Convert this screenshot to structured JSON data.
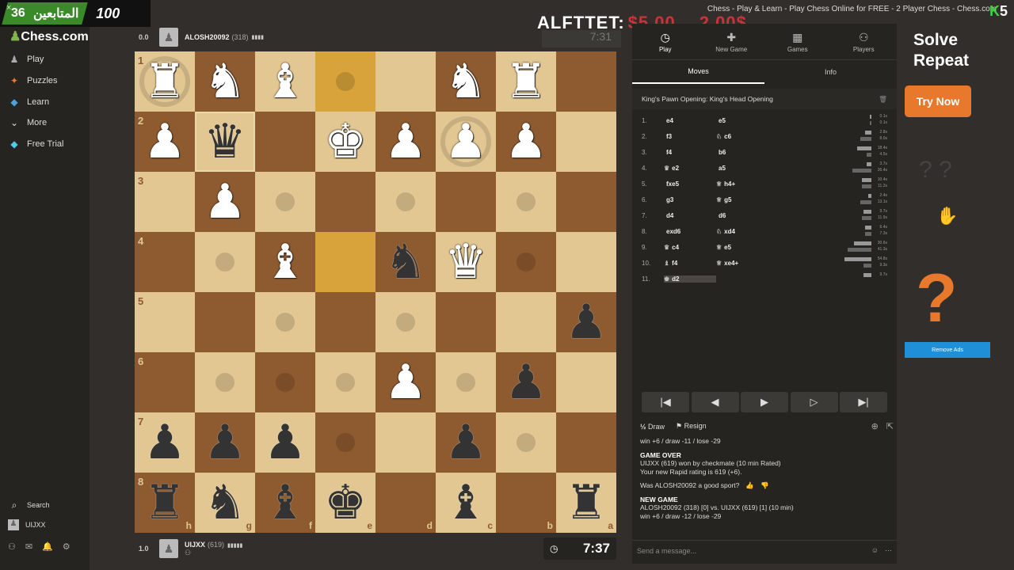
{
  "window": {
    "title": "Chess - Play & Learn - Play Chess Online for FREE - 2 Player Chess - Chess.com",
    "close": "×"
  },
  "stream_overlay": {
    "count_left": "36",
    "followers_label": "المتابعين",
    "count_right": "100",
    "alert_label": "ALFTTET:",
    "alert_amount1": "$5.00",
    "alert_amount2": "2.00$",
    "ghost_time": "7:31",
    "corner_mark": "K5"
  },
  "sidebar": {
    "logo": "Chess.com",
    "items": [
      {
        "label": "Play",
        "icon": "play-icon"
      },
      {
        "label": "Puzzles",
        "icon": "puzzle-icon"
      },
      {
        "label": "Learn",
        "icon": "learn-icon"
      },
      {
        "label": "More",
        "icon": "chevron-down-icon"
      },
      {
        "label": "Free Trial",
        "icon": "diamond-icon"
      }
    ],
    "search": "Search",
    "user": "UIJXX"
  },
  "top_player": {
    "score": "0.0",
    "name": "ALOSH20092",
    "rating": "(318)",
    "flag": "▮▮▮▮"
  },
  "bottom_player": {
    "score": "1.0",
    "name": "UIJXX",
    "rating": "(619)",
    "flag": "▮▮▮▮▮",
    "clock": "7:37"
  },
  "board": {
    "ranks": [
      "1",
      "2",
      "3",
      "4",
      "5",
      "6",
      "7",
      "8"
    ],
    "files": [
      "h",
      "g",
      "f",
      "e",
      "d",
      "c",
      "b",
      "a"
    ],
    "pieces": [
      {
        "r": 0,
        "c": 0,
        "p": "♜",
        "w": true
      },
      {
        "r": 0,
        "c": 1,
        "p": "♞",
        "w": true
      },
      {
        "r": 0,
        "c": 2,
        "p": "♝",
        "w": true
      },
      {
        "r": 0,
        "c": 5,
        "p": "♞",
        "w": true
      },
      {
        "r": 0,
        "c": 6,
        "p": "♜",
        "w": true
      },
      {
        "r": 1,
        "c": 0,
        "p": "♟",
        "w": true
      },
      {
        "r": 1,
        "c": 1,
        "p": "♛",
        "w": false
      },
      {
        "r": 1,
        "c": 3,
        "p": "♚",
        "w": true
      },
      {
        "r": 1,
        "c": 4,
        "p": "♟",
        "w": true
      },
      {
        "r": 1,
        "c": 5,
        "p": "♟",
        "w": true
      },
      {
        "r": 1,
        "c": 6,
        "p": "♟",
        "w": true
      },
      {
        "r": 2,
        "c": 1,
        "p": "♟",
        "w": true
      },
      {
        "r": 3,
        "c": 2,
        "p": "♝",
        "w": true
      },
      {
        "r": 3,
        "c": 4,
        "p": "♞",
        "w": false
      },
      {
        "r": 3,
        "c": 5,
        "p": "♛",
        "w": true
      },
      {
        "r": 4,
        "c": 7,
        "p": "♟",
        "w": false
      },
      {
        "r": 5,
        "c": 4,
        "p": "♟",
        "w": true
      },
      {
        "r": 5,
        "c": 6,
        "p": "♟",
        "w": false
      },
      {
        "r": 6,
        "c": 0,
        "p": "♟",
        "w": false
      },
      {
        "r": 6,
        "c": 1,
        "p": "♟",
        "w": false
      },
      {
        "r": 6,
        "c": 2,
        "p": "♟",
        "w": false
      },
      {
        "r": 6,
        "c": 5,
        "p": "♟",
        "w": false
      },
      {
        "r": 7,
        "c": 0,
        "p": "♜",
        "w": false
      },
      {
        "r": 7,
        "c": 1,
        "p": "♞",
        "w": false
      },
      {
        "r": 7,
        "c": 2,
        "p": "♝",
        "w": false
      },
      {
        "r": 7,
        "c": 3,
        "p": "♚",
        "w": false
      },
      {
        "r": 7,
        "c": 5,
        "p": "♝",
        "w": false
      },
      {
        "r": 7,
        "c": 7,
        "p": "♜",
        "w": false
      }
    ]
  },
  "panel": {
    "tabs": [
      {
        "label": "Play",
        "icon": "clock-icon"
      },
      {
        "label": "New Game",
        "icon": "plus-icon"
      },
      {
        "label": "Games",
        "icon": "board-icon"
      },
      {
        "label": "Players",
        "icon": "players-icon"
      }
    ],
    "subtabs": [
      "Moves",
      "Info"
    ],
    "opening": "King's Pawn Opening: King's Head Opening",
    "moves": [
      {
        "n": "1.",
        "w": "e4",
        "wp": "",
        "b": "e5",
        "bp": "",
        "t1": "0.1s",
        "t2": "0.1s",
        "b1": 2,
        "b2": 2
      },
      {
        "n": "2.",
        "w": "f3",
        "wp": "",
        "b": "c6",
        "bp": "♘",
        "t1": "2.8s",
        "t2": "8.0s",
        "b1": 8,
        "b2": 14
      },
      {
        "n": "3.",
        "w": "f4",
        "wp": "",
        "b": "b6",
        "bp": "",
        "t1": "18.4s",
        "t2": "4.5s",
        "b1": 18,
        "b2": 6
      },
      {
        "n": "4.",
        "w": "e2",
        "wp": "♛",
        "b": "a5",
        "bp": "",
        "t1": "3.7s",
        "t2": "26.4s",
        "b1": 6,
        "b2": 24
      },
      {
        "n": "5.",
        "w": "fxe5",
        "wp": "",
        "b": "h4+",
        "bp": "♕",
        "t1": "10.4s",
        "t2": "11.2s",
        "b1": 12,
        "b2": 12
      },
      {
        "n": "6.",
        "w": "g3",
        "wp": "",
        "b": "g5",
        "bp": "♕",
        "t1": "2.4s",
        "t2": "13.1s",
        "b1": 4,
        "b2": 14
      },
      {
        "n": "7.",
        "w": "d4",
        "wp": "",
        "b": "d6",
        "bp": "",
        "t1": "9.7s",
        "t2": "11.9s",
        "b1": 10,
        "b2": 12
      },
      {
        "n": "8.",
        "w": "exd6",
        "wp": "",
        "b": "xd4",
        "bp": "♘",
        "t1": "6.4s",
        "t2": "7.3s",
        "b1": 8,
        "b2": 8
      },
      {
        "n": "9.",
        "w": "c4",
        "wp": "♛",
        "b": "e5",
        "bp": "♕",
        "t1": "30.6s",
        "t2": "41.3s",
        "b1": 22,
        "b2": 30
      },
      {
        "n": "10.",
        "w": "f4",
        "wp": "♝",
        "b": "xe4+",
        "bp": "♕",
        "t1": "54.8s",
        "t2": "9.3s",
        "b1": 34,
        "b2": 10
      },
      {
        "n": "11.",
        "w": "d2",
        "wp": "♚",
        "b": "",
        "bp": "",
        "t1": "9.7s",
        "t2": "",
        "b1": 10,
        "b2": 0
      }
    ],
    "controls": [
      "⏮",
      "◀",
      "▶",
      "▷",
      "⏭"
    ],
    "draw": "Draw",
    "resign": "Resign",
    "chat": {
      "line1": "win +6 / draw -11 / lose -29",
      "game_over": "GAME OVER",
      "result": "UIJXX (619) won by checkmate (10 min Rated)",
      "rating": "Your new Rapid rating is 619 (+6).",
      "sport": "Was ALOSH20092 a good sport?",
      "new_game": "NEW GAME",
      "matchup": "ALOSH20092 (318) [0] vs. UIJXX (619) [1] (10 min)",
      "line2": "win +6 / draw -12 / lose -29"
    },
    "send_placeholder": "Send a message..."
  },
  "ad": {
    "headline1": "Solve",
    "headline2": "Repeat",
    "cta": "Try Now",
    "remove": "Remove Ads",
    "question": "?",
    "faint": "? ?"
  },
  "colors": {
    "light": "#e3c792",
    "dark": "#8e5a2f",
    "highlight": "#d8a33a",
    "accent": "#81b64c",
    "orange": "#e8782b"
  }
}
